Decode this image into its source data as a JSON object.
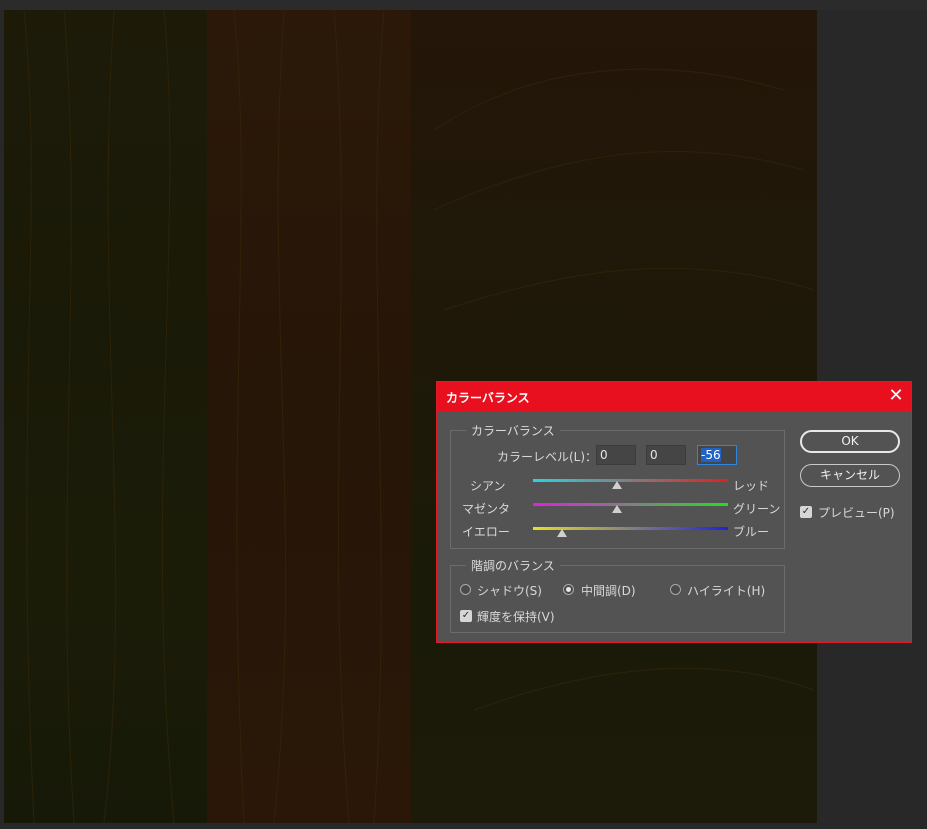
{
  "dialog": {
    "title": "カラーバランス",
    "close_glyph": "✕",
    "color_balance": {
      "group_title": "カラーバランス",
      "levels_label": "カラーレベル(L)：",
      "levels": [
        "0",
        "0",
        "-56"
      ],
      "sliders": [
        {
          "left": "シアン",
          "right": "レッド",
          "value": 0,
          "colors": [
            "#28d4e0",
            "#e02020"
          ]
        },
        {
          "left": "マゼンタ",
          "right": "グリーン",
          "value": 0,
          "colors": [
            "#e020e0",
            "#20e020"
          ]
        },
        {
          "left": "イエロー",
          "right": "ブルー",
          "value": -56,
          "colors": [
            "#e8e020",
            "#2020e0"
          ]
        }
      ]
    },
    "tone_balance": {
      "group_title": "階調のバランス",
      "options": [
        "シャドウ(S)",
        "中間調(D)",
        "ハイライト(H)"
      ],
      "selected": "中間調(D)",
      "preserve_label": "輝度を保持(V)",
      "preserve_checked": true
    },
    "buttons": {
      "ok": "OK",
      "cancel": "キャンセル"
    },
    "preview_label": "プレビュー(P)",
    "preview_checked": true
  }
}
